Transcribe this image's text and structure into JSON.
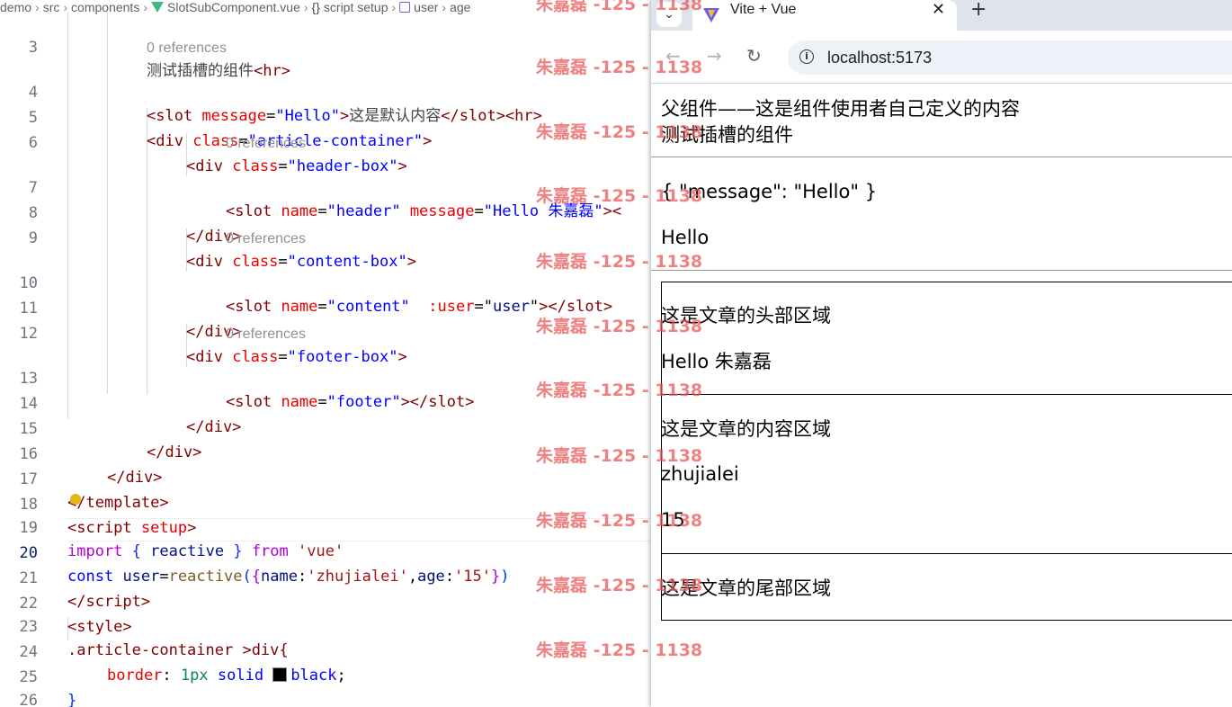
{
  "editor": {
    "breadcrumb": [
      "demo",
      "src",
      "components",
      "SlotSubComponent.vue",
      "script setup",
      "user",
      "age"
    ],
    "code_lens": "0 references",
    "lines": [
      {
        "n": "3"
      },
      {
        "n": "4"
      },
      {
        "n": "5"
      },
      {
        "n": "6"
      },
      {
        "n": "7"
      },
      {
        "n": "8"
      },
      {
        "n": "9"
      },
      {
        "n": "10"
      },
      {
        "n": "11"
      },
      {
        "n": "12"
      },
      {
        "n": "13"
      },
      {
        "n": "14"
      },
      {
        "n": "15"
      },
      {
        "n": "16"
      },
      {
        "n": "17"
      },
      {
        "n": "18"
      },
      {
        "n": "19"
      },
      {
        "n": "20"
      },
      {
        "n": "21"
      },
      {
        "n": "22"
      },
      {
        "n": "23"
      },
      {
        "n": "24"
      },
      {
        "n": "25"
      },
      {
        "n": "26"
      }
    ],
    "code": {
      "l3_text": "测试插槽的组件",
      "l4_msg": "Hello",
      "l4_text": "这是默认内容",
      "l5_class": "article-container",
      "l6_class": "header-box",
      "l7_name": "header",
      "l7_msg": "Hello 朱嘉磊",
      "l9_class": "content-box",
      "l10_name": "content",
      "l10_user": "user",
      "l12_class": "footer-box",
      "l13_name": "footer",
      "l19_module": "'vue'",
      "l20_name": "'zhujialei'",
      "l20_age": "'15'",
      "l23_selector": ".article-container >div{",
      "l24_prop": "border",
      "l24_num": "1px",
      "l24_kw": "solid",
      "l24_color": "black"
    }
  },
  "browser": {
    "tab_title": "Vite + Vue",
    "url": "localhost:5173",
    "page": {
      "parent_text": "父组件——这是组件使用者自己定义的内容",
      "child_title": "测试插槽的组件",
      "props_json": "{ \"message\": \"Hello\" }",
      "default_message": "Hello",
      "header_area": "这是文章的头部区域",
      "header_message": "Hello 朱嘉磊",
      "content_area": "这是文章的内容区域",
      "user_name": "zhujialei",
      "user_age": "15",
      "footer_area": "这是文章的尾部区域"
    }
  },
  "watermark": {
    "text": "朱嘉磊 -125 - 1138"
  },
  "colors": {
    "accent_vue": "#42b883",
    "watermark": "#e85050"
  }
}
